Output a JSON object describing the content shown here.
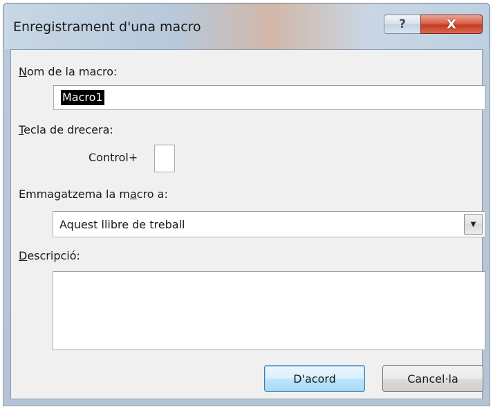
{
  "window": {
    "title": "Enregistrament d'una macro",
    "help_label": "?",
    "close_label": "X"
  },
  "form": {
    "macro_name": {
      "label_accel": "N",
      "label_rest": "om de la macro:",
      "value": "Macro1"
    },
    "shortcut": {
      "label_accel": "T",
      "label_rest": "ecla de drecera:",
      "modifier": "Control+",
      "key_value": ""
    },
    "store_in": {
      "label_before": "Emmagatzema la m",
      "label_accel": "a",
      "label_after": "cro a:",
      "selected": "Aquest llibre de treball"
    },
    "description": {
      "label_accel": "D",
      "label_rest": "escripció:",
      "value": ""
    }
  },
  "buttons": {
    "ok": "D'acord",
    "cancel": "Cancel·la"
  },
  "icons": {
    "dropdown": "chevron-down-icon"
  }
}
